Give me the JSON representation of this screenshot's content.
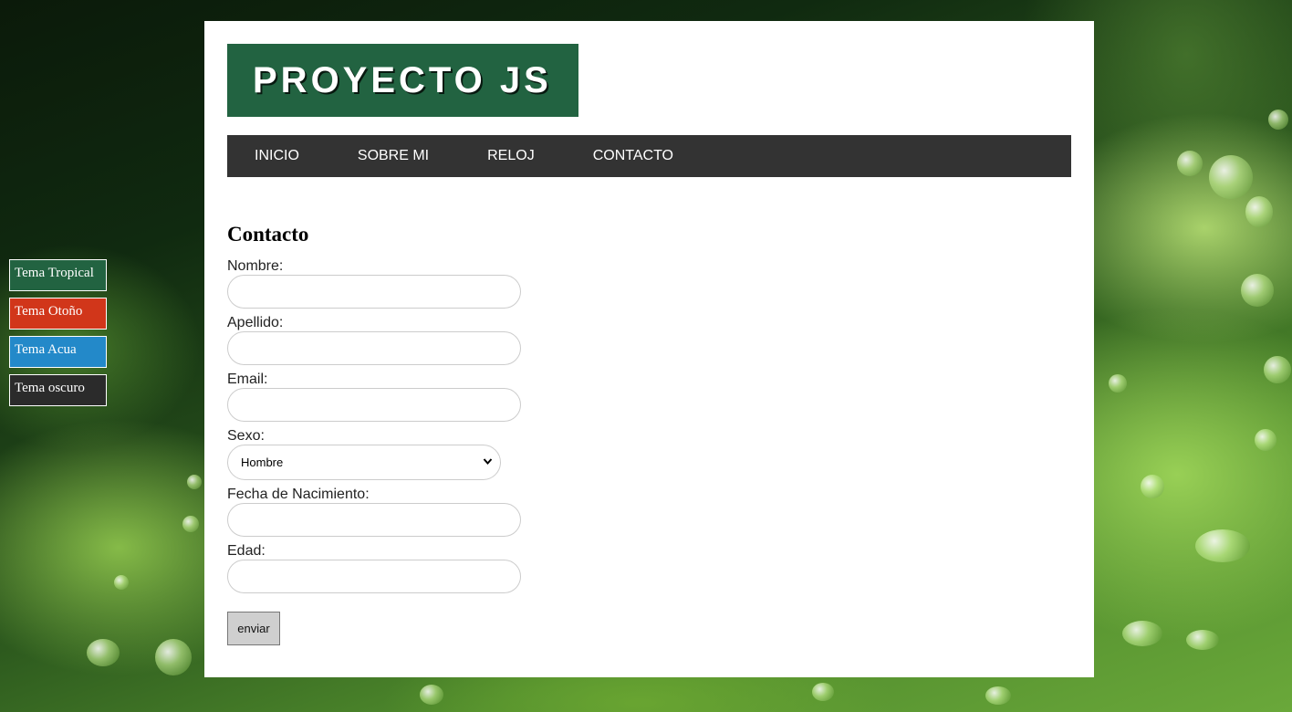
{
  "themes": [
    {
      "label": "Tema Tropical",
      "color": "#226341"
    },
    {
      "label": "Tema Otoño",
      "color": "#d1361a"
    },
    {
      "label": "Tema Acua",
      "color": "#2389c9"
    },
    {
      "label": "Tema oscuro",
      "color": "#2b2b2b"
    }
  ],
  "header": {
    "logo_text": "PROYECTO JS",
    "logo_color": "#226341"
  },
  "nav": {
    "items": [
      "INICIO",
      "SOBRE MI",
      "RELOJ",
      "CONTACTO"
    ],
    "background": "#333333"
  },
  "form": {
    "title": "Contacto",
    "nombre_label": "Nombre:",
    "nombre_value": "",
    "apellido_label": "Apellido:",
    "apellido_value": "",
    "email_label": "Email:",
    "email_value": "",
    "sexo_label": "Sexo:",
    "sexo_selected": "Hombre",
    "fecha_label": "Fecha de Nacimiento:",
    "fecha_value": "",
    "edad_label": "Edad:",
    "edad_value": "",
    "submit_label": "enviar"
  }
}
